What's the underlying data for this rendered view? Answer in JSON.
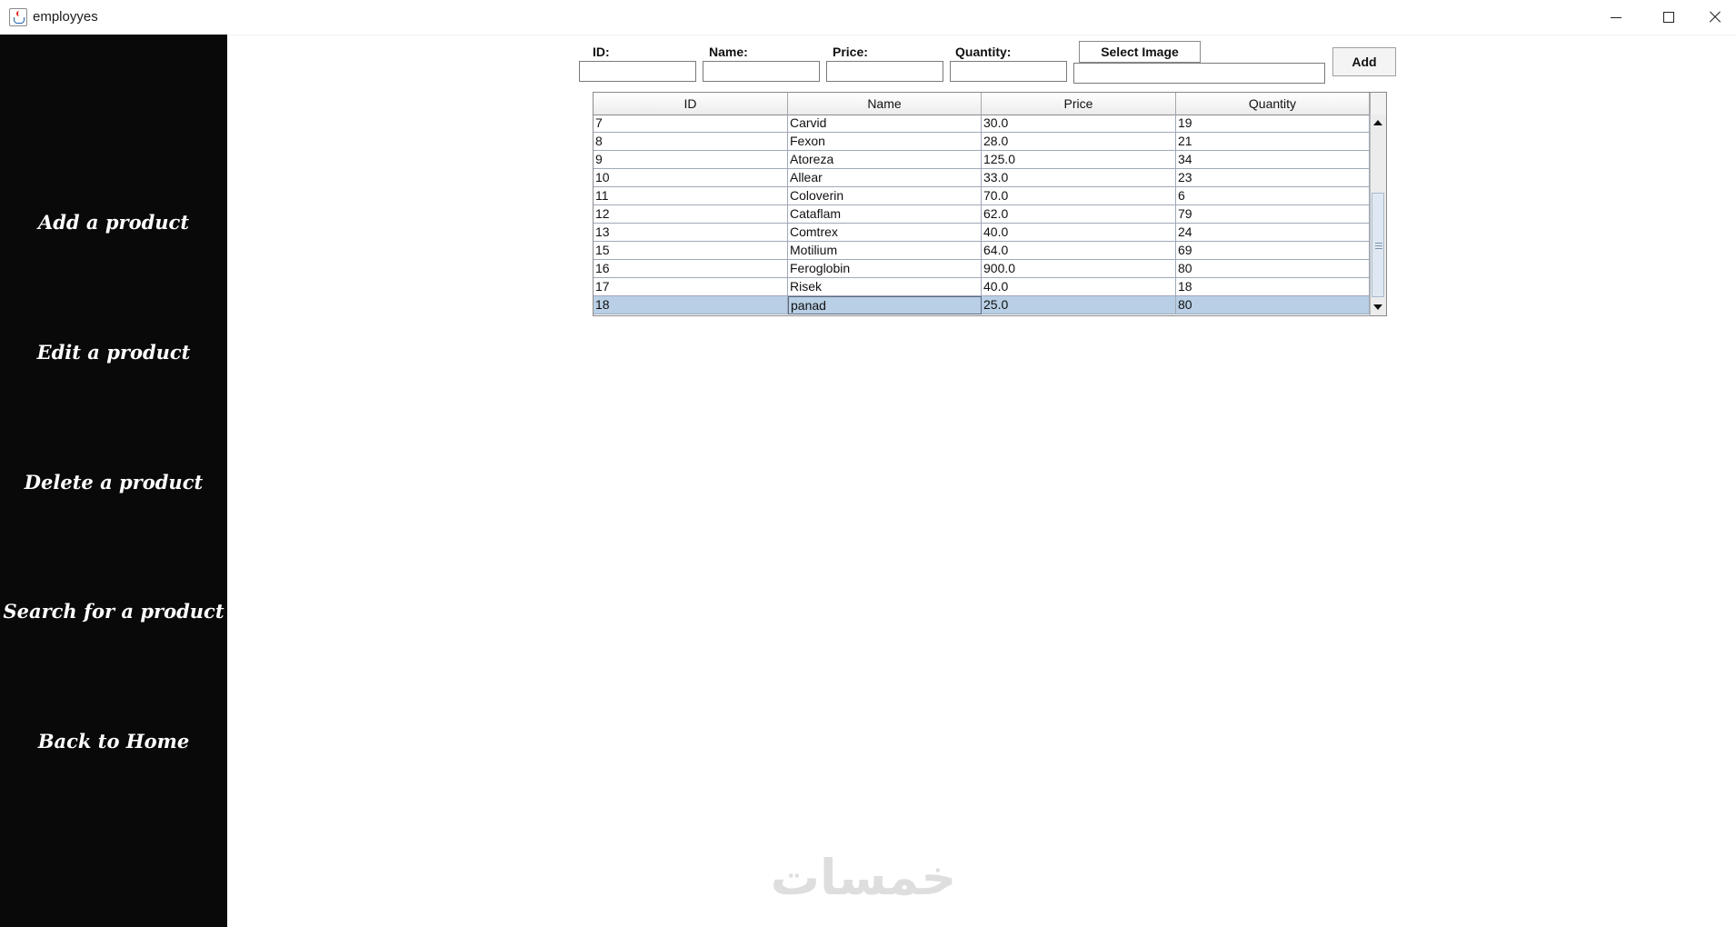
{
  "window": {
    "title": "employyes"
  },
  "sidebar": {
    "items": [
      {
        "label": "Add a product"
      },
      {
        "label": "Edit a product"
      },
      {
        "label": "Delete a product"
      },
      {
        "label": "Search for a product"
      },
      {
        "label": "Back to Home"
      }
    ]
  },
  "form": {
    "id_label": "ID:",
    "name_label": "Name:",
    "price_label": "Price:",
    "quantity_label": "Quantity:",
    "id_value": "",
    "name_value": "",
    "price_value": "",
    "quantity_value": "",
    "image_path_value": "",
    "select_image_label": "Select Image",
    "add_label": "Add"
  },
  "table": {
    "columns": [
      "ID",
      "Name",
      "Price",
      "Quantity"
    ],
    "rows": [
      [
        "7",
        "Carvid",
        "30.0",
        "19"
      ],
      [
        "8",
        "Fexon",
        "28.0",
        "21"
      ],
      [
        "9",
        "Atoreza",
        "125.0",
        "34"
      ],
      [
        "10",
        "Allear",
        "33.0",
        "23"
      ],
      [
        "11",
        "Coloverin",
        "70.0",
        "6"
      ],
      [
        "12",
        "Cataflam",
        "62.0",
        "79"
      ],
      [
        "13",
        "Comtrex",
        "40.0",
        "24"
      ],
      [
        "15",
        "Motilium",
        "64.0",
        "69"
      ],
      [
        "16",
        "Feroglobin",
        "900.0",
        "80"
      ],
      [
        "17",
        "Risek",
        "40.0",
        "18"
      ],
      [
        "18",
        "panad",
        "25.0",
        "80"
      ]
    ],
    "selected_row": 10
  },
  "watermark": "خمسات"
}
